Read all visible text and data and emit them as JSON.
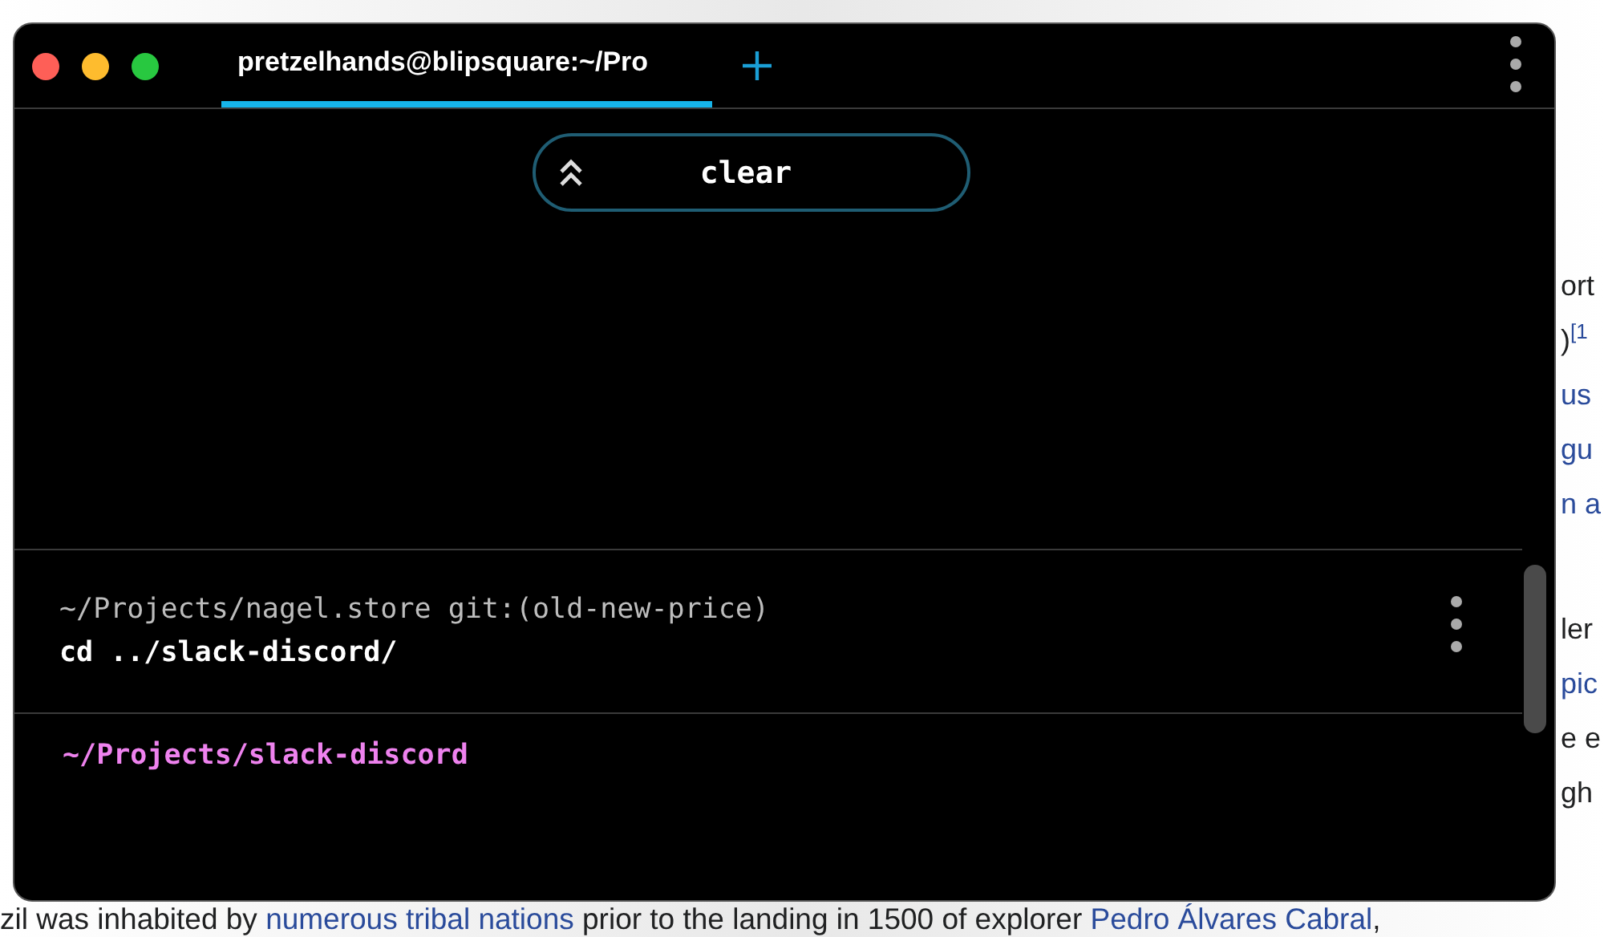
{
  "page": {
    "paragraphs": [
      [
        {
          "text": "ort",
          "link": false
        },
        {
          "text": ")$^{[1}$",
          "link": false
        },
        {
          "text": "us",
          "link": true
        },
        {
          "text": "gu",
          "link": true
        },
        {
          "text": "n a",
          "link": true
        }
      ],
      [
        {
          "text": "ler",
          "link": false
        },
        {
          "text": "pic",
          "link": true
        },
        {
          "text": "e e",
          "link": false
        },
        {
          "text": "gh",
          "link": false
        }
      ]
    ],
    "footer_line": [
      {
        "text": "zil was inhabited by ",
        "link": false
      },
      {
        "text": "numerous tribal nations",
        "link": true
      },
      {
        "text": " prior to the landing in 1500 of explorer ",
        "link": false
      },
      {
        "text": "Pedro Álvares Cabral",
        "link": true
      },
      {
        "text": ",",
        "link": false
      }
    ]
  },
  "window": {
    "tab": {
      "title": "pretzelhands@blipsquare:~/Pro",
      "selected": true
    },
    "clear_button": {
      "label": "clear"
    },
    "blocks": [
      {
        "prompt": "~/Projects/nagel.store git:(old-new-price)",
        "command": "cd ../slack-discord/"
      }
    ],
    "active_prompt": "~/Projects/slack-discord"
  }
}
